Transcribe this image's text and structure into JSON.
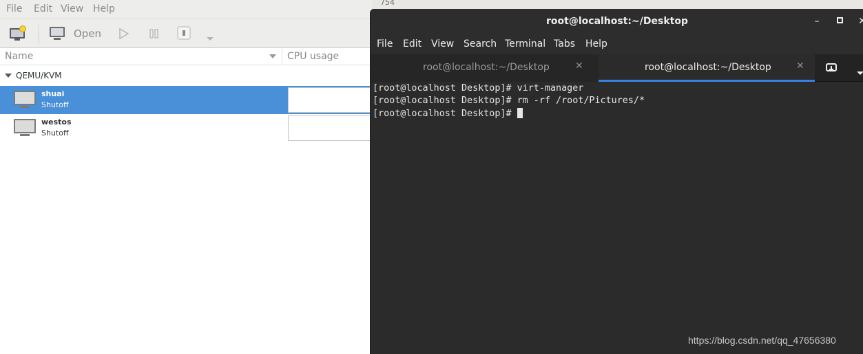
{
  "virt_manager": {
    "menu": [
      "File",
      "Edit",
      "View",
      "Help"
    ],
    "toolbar": {
      "open_label": "Open"
    },
    "columns": {
      "name": "Name",
      "cpu": "CPU usage"
    },
    "group": "QEMU/KVM",
    "vms": [
      {
        "name": "shuai",
        "state": "Shutoff",
        "selected": true
      },
      {
        "name": "westos",
        "state": "Shutoff",
        "selected": false
      }
    ]
  },
  "background_window": {
    "fragment": "754"
  },
  "terminal": {
    "title": "root@localhost:~/Desktop",
    "menu": [
      "File",
      "Edit",
      "View",
      "Search",
      "Terminal",
      "Tabs",
      "Help"
    ],
    "tabs": [
      {
        "label": "root@localhost:~/Desktop",
        "active": false
      },
      {
        "label": "root@localhost:~/Desktop",
        "active": true
      }
    ],
    "lines": [
      "[root@localhost Desktop]# virt-manager",
      "[root@localhost Desktop]# rm -rf /root/Pictures/*",
      "[root@localhost Desktop]# "
    ],
    "window_buttons": {
      "minimize": "–",
      "maximize": "▫",
      "close": "✕"
    }
  },
  "watermark": "https://blog.csdn.net/qq_47656380",
  "colors": {
    "selection": "#4a90d9",
    "terminal_bg": "#2b2b2b",
    "tab_accent": "#3584e4"
  }
}
